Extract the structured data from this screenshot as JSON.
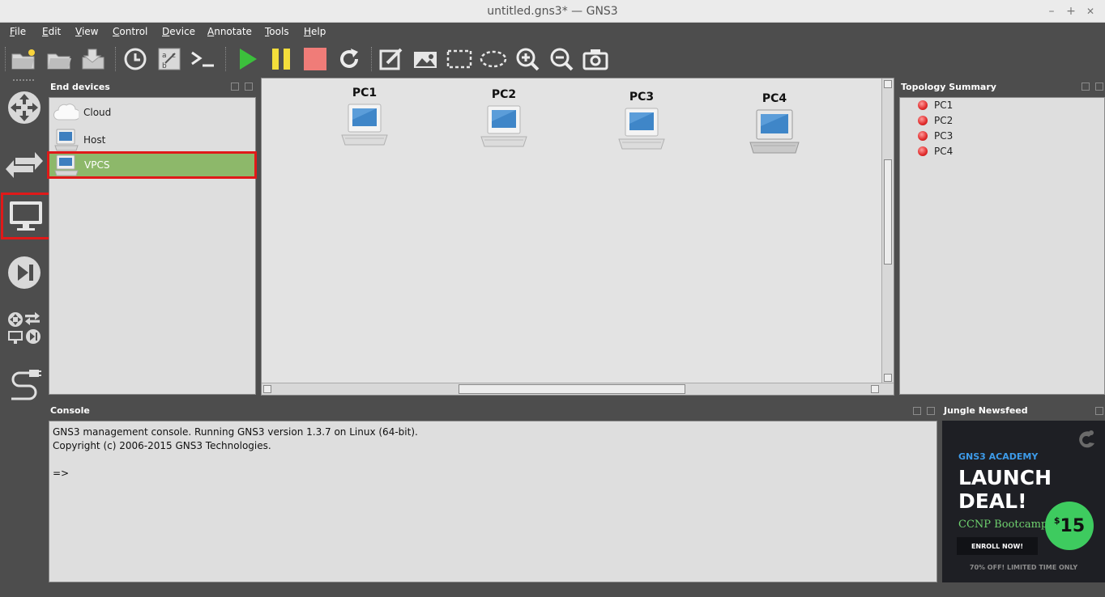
{
  "window": {
    "title": "untitled.gns3* — GNS3",
    "minimize": "–",
    "maximize": "+",
    "close": "✕"
  },
  "menu": {
    "items": [
      "File",
      "Edit",
      "View",
      "Control",
      "Device",
      "Annotate",
      "Tools",
      "Help"
    ]
  },
  "toolbar": {
    "buttons": [
      "new-project",
      "open-project",
      "save-project",
      "snapshot",
      "show-interface-labels",
      "console-all",
      "start-all",
      "suspend-all",
      "stop-all",
      "reload-all",
      "add-note",
      "insert-picture",
      "draw-rectangle",
      "draw-ellipse",
      "zoom-in",
      "zoom-out",
      "screenshot"
    ],
    "colors": {
      "start": "#3cbf3c",
      "suspend": "#f4de3b",
      "stop": "#f07c78"
    }
  },
  "device_bar": {
    "buttons": [
      "routers",
      "switches",
      "end-devices",
      "security-devices",
      "all-devices",
      "add-link"
    ],
    "selected": "end-devices"
  },
  "end_devices": {
    "title": "End devices",
    "items": [
      {
        "label": "Cloud",
        "icon": "cloud-icon"
      },
      {
        "label": "Host",
        "icon": "host-icon"
      },
      {
        "label": "VPCS",
        "icon": "vpcs-icon",
        "selected": true
      }
    ],
    "selection_color": "#8db86a",
    "highlight_color": "#e01919"
  },
  "canvas": {
    "nodes": [
      {
        "label": "PC1"
      },
      {
        "label": "PC2"
      },
      {
        "label": "PC3"
      },
      {
        "label": "PC4"
      }
    ]
  },
  "topology_summary": {
    "title": "Topology Summary",
    "items": [
      "PC1",
      "PC2",
      "PC3",
      "PC4"
    ],
    "status_color": "#e02a2a"
  },
  "console": {
    "title": "Console",
    "lines": [
      "GNS3 management console. Running GNS3 version 1.3.7 on Linux (64-bit).",
      "Copyright (c) 2006-2015 GNS3 Technologies.",
      "",
      "=>"
    ]
  },
  "newsfeed": {
    "title": "Jungle Newsfeed",
    "brand": "GNS3 ACADEMY",
    "headline_1": "LAUNCH",
    "headline_2": "DEAL!",
    "course": "CCNP Bootcamp",
    "price_symbol": "$",
    "price": "15",
    "cta": "ENROLL NOW!",
    "footer": "70% OFF! LIMITED TIME ONLY",
    "colors": {
      "brand": "#3d9be9",
      "course": "#6fd26f",
      "badge": "#3ecb5f"
    }
  }
}
